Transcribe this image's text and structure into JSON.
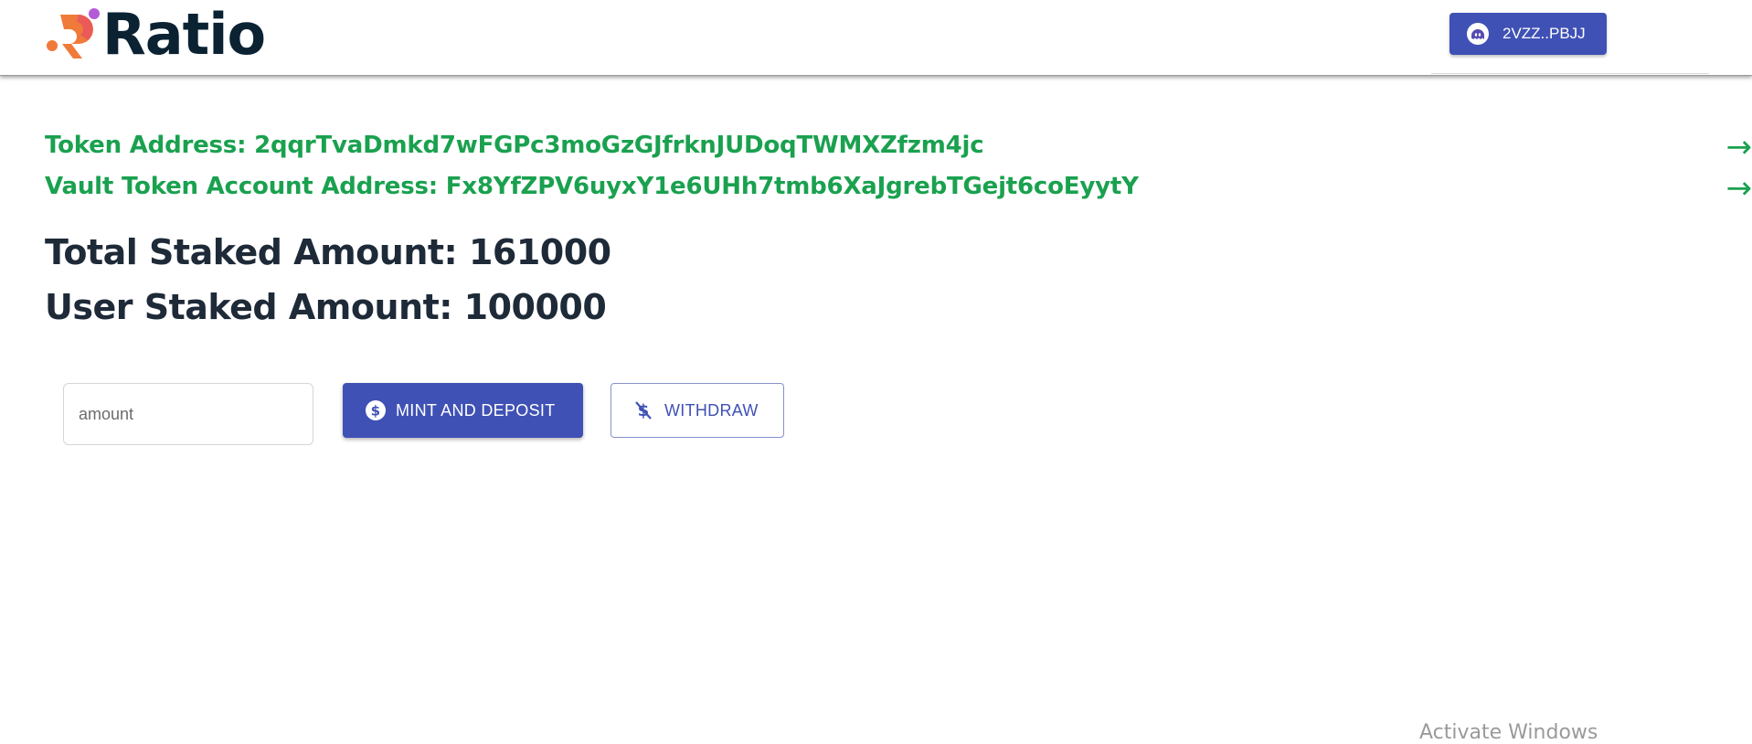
{
  "header": {
    "logo_text": "Ratio",
    "wallet_button_label": "2VZZ..PBJJ"
  },
  "addresses": {
    "token_address": "Token Address: 2qqrTvaDmkd7wFGPc3moGzGJfrknJUDoqTWMXZfzm4jc",
    "vault_token_account_address": "Vault Token Account Address: Fx8YfZPV6uyxY1e6UHh7tmb6XaJgrebTGejt6coEyytY",
    "arrow_glyph": "→"
  },
  "stats": {
    "total_staked": "Total Staked Amount: 161000",
    "user_staked": "User Staked Amount: 100000"
  },
  "actions": {
    "amount_placeholder": "amount",
    "amount_value": "",
    "mint_label": "MINT AND DEPOSIT",
    "withdraw_label": "WITHDRAW"
  },
  "os": {
    "watermark": "Activate Windows"
  },
  "colors": {
    "primary": "#3f51b5",
    "address_green": "#1aa14f",
    "heading": "#1e2a38",
    "logo_orange": "#f07a3a",
    "logo_purple": "#b35bd6"
  },
  "icons": {
    "wallet": "phantom-ghost-icon",
    "mint": "dollar-circle-icon",
    "withdraw": "money-off-icon",
    "address_link": "arrow-right-icon"
  }
}
